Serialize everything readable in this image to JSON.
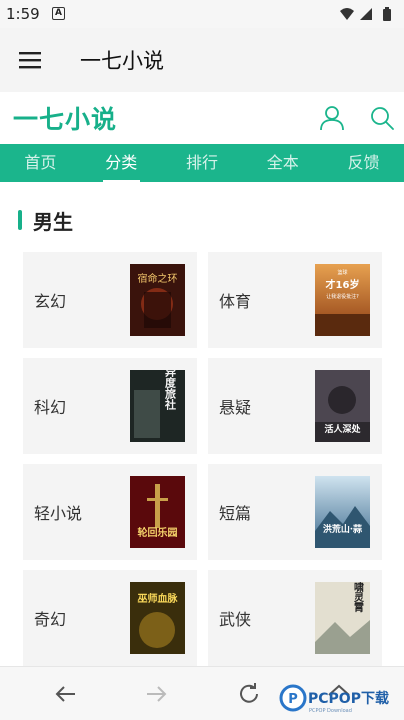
{
  "status": {
    "time": "1:59",
    "notification": "A"
  },
  "app_bar": {
    "title": "一七小说"
  },
  "site": {
    "logo": "一七小说"
  },
  "nav": {
    "tabs": [
      "首页",
      "分类",
      "排行",
      "全本",
      "反馈"
    ],
    "active_index": 1
  },
  "section": {
    "title": "男生"
  },
  "categories": [
    {
      "label": "玄幻",
      "cover_title": "宿命之环",
      "cover_color": "#5a1e12"
    },
    {
      "label": "体育",
      "cover_title": "才16岁",
      "cover_subtitle": "让我退役批注?",
      "cover_tag": "篮球",
      "cover_color": "#c9732a"
    },
    {
      "label": "科幻",
      "cover_title": "异度旅社",
      "cover_color": "#2f3a36"
    },
    {
      "label": "悬疑",
      "cover_title": "活人深处",
      "cover_color": "#3b3540"
    },
    {
      "label": "轻小说",
      "cover_title": "轮回乐园",
      "cover_color": "#7e1014"
    },
    {
      "label": "短篇",
      "cover_title": "洪荒山·蒜",
      "cover_color": "#5f8fb5"
    },
    {
      "label": "奇幻",
      "cover_title": "巫师血脉",
      "cover_color": "#5e4a14"
    },
    {
      "label": "武侠",
      "cover_title": "剑啸灵霄",
      "cover_color": "#cfcab8"
    }
  ],
  "watermark": {
    "brand": "PCPOP下载",
    "sub": "PCPOP Download"
  },
  "colors": {
    "accent": "#1bb58c",
    "logo": "#17b08a"
  },
  "icons": [
    "menu-icon",
    "user-icon",
    "search-icon",
    "back-arrow-icon",
    "forward-arrow-icon",
    "refresh-icon",
    "home-icon",
    "wifi-icon",
    "signal-icon",
    "battery-icon"
  ]
}
